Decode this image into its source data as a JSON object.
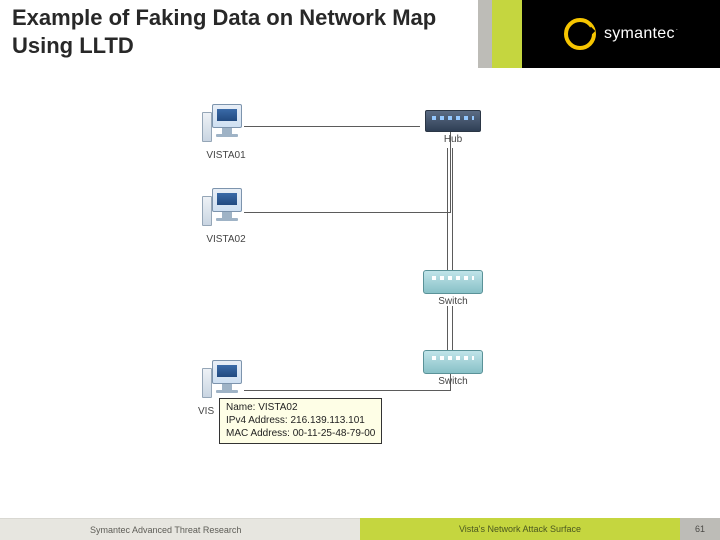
{
  "title": "Example of Faking Data on Network Map Using LLTD",
  "brand": {
    "name": "symantec",
    "trademark": "."
  },
  "nodes": {
    "vista01": "VISTA01",
    "vista02": "VISTA02",
    "vista02b_prefix": "VIS",
    "hub": "Hub",
    "switch1": "Switch",
    "switch2": "Switch"
  },
  "tooltip": {
    "line1_label": "Name:",
    "line1_value": "VISTA02",
    "line2_label": "IPv4 Address:",
    "line2_value": "216.139.113.101",
    "line3_label": "MAC Address:",
    "line3_value": "00-11-25-48-79-00"
  },
  "footer": {
    "left": "Symantec Advanced Threat Research",
    "mid": "Vista's Network Attack Surface",
    "page": "61"
  }
}
